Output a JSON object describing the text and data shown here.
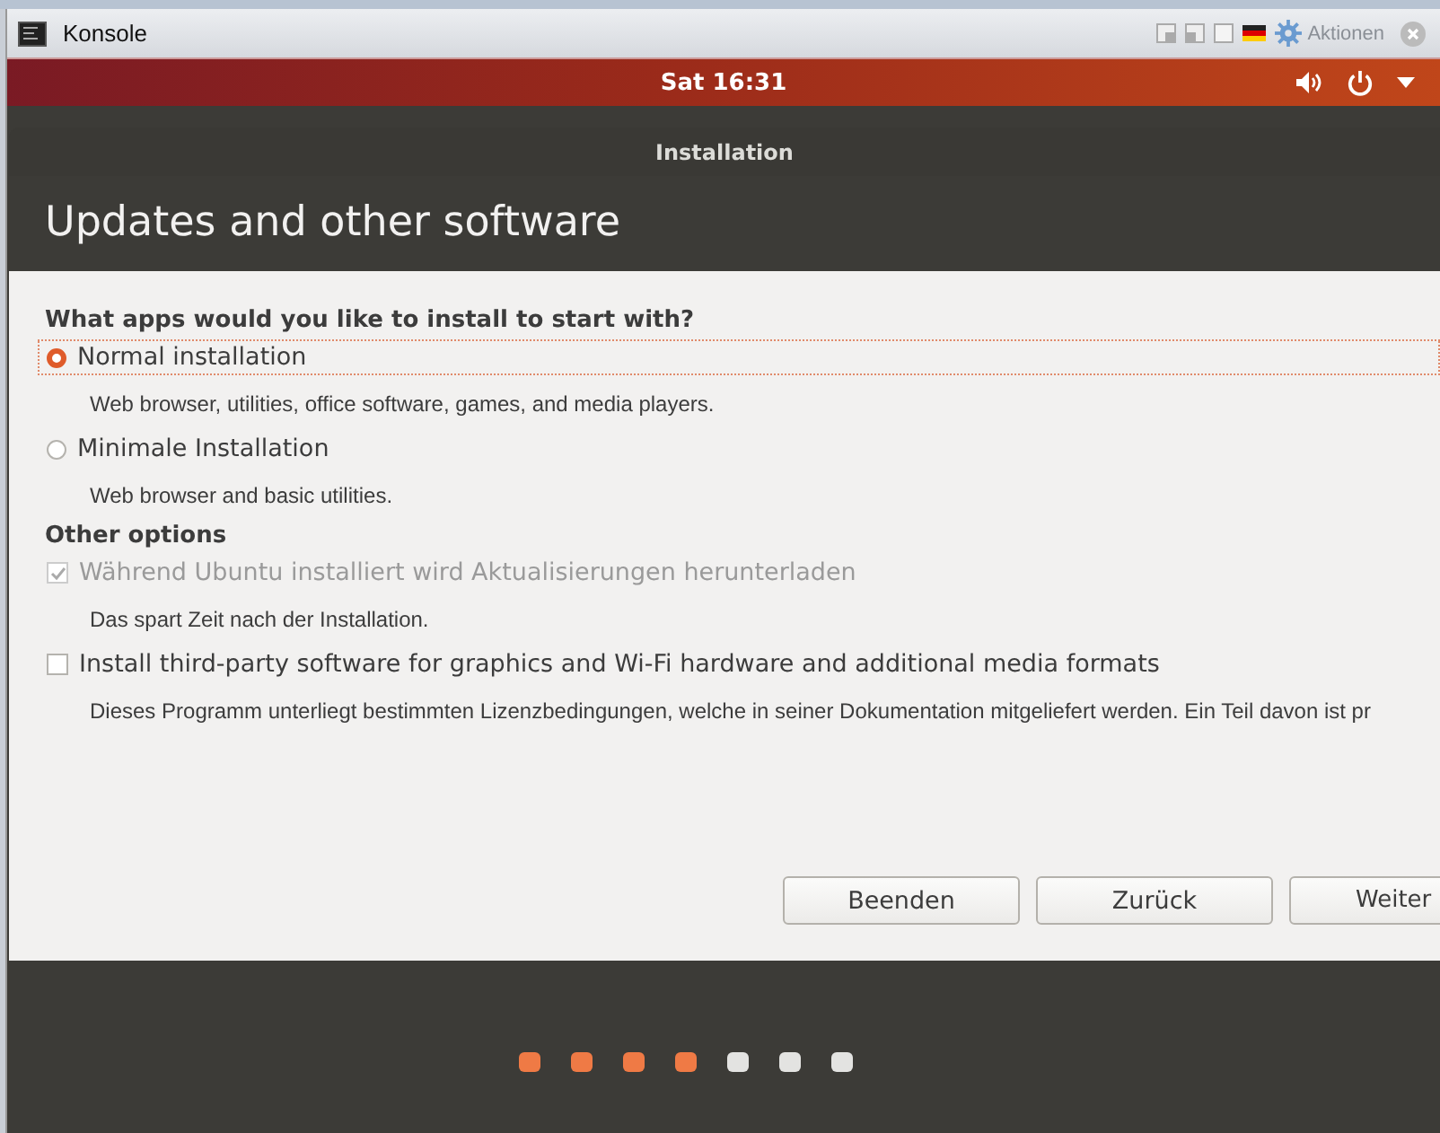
{
  "window": {
    "title": "Konsole",
    "actions_label": "Aktionen"
  },
  "top_bar": {
    "clock": "Sat 16:31"
  },
  "dialog": {
    "title": "Installation",
    "heading": "Updates and other software",
    "sections": [
      {
        "heading": "What apps would you like to install to start with?",
        "options": [
          {
            "kind": "radio",
            "label": "Normal installation",
            "description": "Web browser, utilities, office software, games, and media players.",
            "selected": true
          },
          {
            "kind": "radio",
            "label": "Minimale Installation",
            "description": "Web browser and basic utilities.",
            "selected": false
          }
        ]
      },
      {
        "heading": "Other options",
        "options": [
          {
            "kind": "checkbox",
            "label": "Während Ubuntu installiert wird Aktualisierungen herunterladen",
            "description": "Das spart Zeit nach der Installation.",
            "checked": true,
            "disabled": true
          },
          {
            "kind": "checkbox",
            "label": "Install third-party software for graphics and Wi-Fi hardware and additional media formats",
            "description": "Dieses Programm unterliegt bestimmten Lizenzbedingungen, welche in seiner Dokumentation mitgeliefert werden. Ein Teil davon ist pr",
            "checked": false,
            "disabled": false
          }
        ]
      }
    ],
    "buttons": [
      "Beenden",
      "Zurück",
      "Weiter"
    ]
  },
  "progress": [
    {
      "done": true
    },
    {
      "done": true
    },
    {
      "done": true
    },
    {
      "done": true
    },
    {
      "done": false
    },
    {
      "done": false
    },
    {
      "done": false
    }
  ]
}
